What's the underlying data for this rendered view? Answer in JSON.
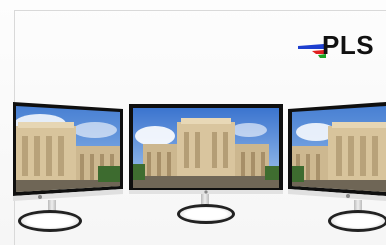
{
  "logo": {
    "text": "PLS",
    "accent_colors": [
      "#1d3fcf",
      "#e02020",
      "#1aa321"
    ]
  },
  "monitors": [
    {
      "name": "left",
      "perspective": "angled-left"
    },
    {
      "name": "center",
      "perspective": "front"
    },
    {
      "name": "right",
      "perspective": "angled-right"
    }
  ],
  "colors": {
    "bezel": "#0f0f0f",
    "sky": "#5a8fd9",
    "building": "#d9c6a1",
    "stand": "#1a1a1a"
  }
}
